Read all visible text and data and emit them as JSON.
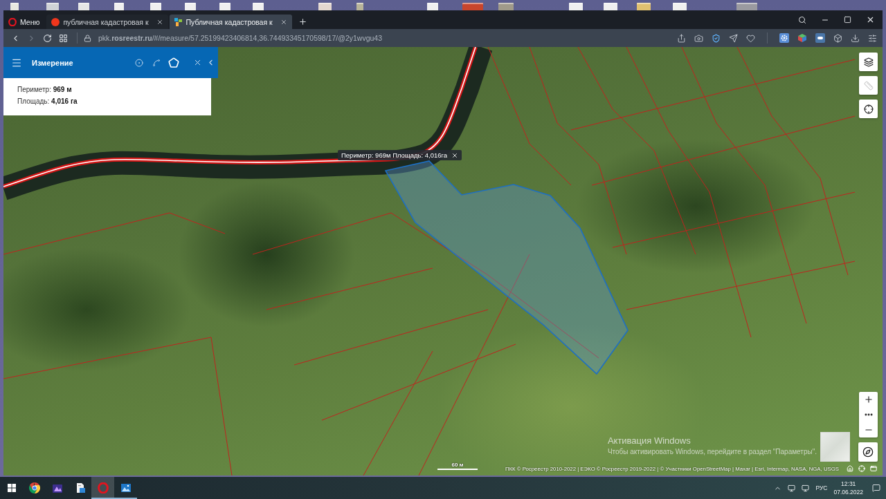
{
  "browser": {
    "menu_label": "Меню",
    "tabs": [
      {
        "kind": "search_engine",
        "title": "публичная кадастровая к",
        "selected": false
      },
      {
        "kind": "cadastre",
        "title": "Публичная кадастровая к",
        "selected": true
      }
    ],
    "nav_buttons": [
      {
        "kind": "back",
        "disabled": false
      },
      {
        "kind": "forward",
        "disabled": true
      },
      {
        "kind": "reload",
        "disabled": false
      },
      {
        "kind": "speed_dial",
        "disabled": false
      }
    ],
    "address": "pkk.**rosreestr.ru**/#/measure/57.25199423406814,36.74493345170598/17/@2y1wvgu43"
  },
  "measure_panel": {
    "title": "Измерение",
    "tools": [
      {
        "kind": "point",
        "selected": false
      },
      {
        "kind": "line",
        "selected": false
      },
      {
        "kind": "polygon",
        "selected": true
      }
    ],
    "results": [
      "Периметр: **969 м**",
      "Площадь: **4,016 га**"
    ]
  },
  "map": {
    "tooltip": "Периметр: 969м Площадь: 4,016га",
    "side_tools": [
      {
        "kind": "layers",
        "disabled": false
      },
      {
        "kind": "ruler",
        "disabled": true
      },
      {
        "kind": "locate",
        "disabled": false
      }
    ],
    "scale": "60 м",
    "attribution": "ПКК © Росреестр 2010-2022 | ЕЭКО © Росреестр 2019-2022 | © Участники OpenStreetMap | Maxar | Esri, Intermap, NASA, NGA, USGS"
  },
  "activation_notice": {
    "title": "Активация Windows",
    "text": "Чтобы активировать Windows, перейдите в раздел \"Параметры\"."
  },
  "taskbar": {
    "apps": [
      {
        "kind": "chrome",
        "selected": false,
        "running": false
      },
      {
        "kind": "purple_app",
        "selected": false,
        "running": false
      },
      {
        "kind": "file",
        "selected": false,
        "running": false
      },
      {
        "kind": "opera",
        "selected": true,
        "running": true
      },
      {
        "kind": "photos",
        "selected": false,
        "running": true
      }
    ],
    "language": "РУС",
    "time": "12:31",
    "date": "07.06.2022"
  }
}
